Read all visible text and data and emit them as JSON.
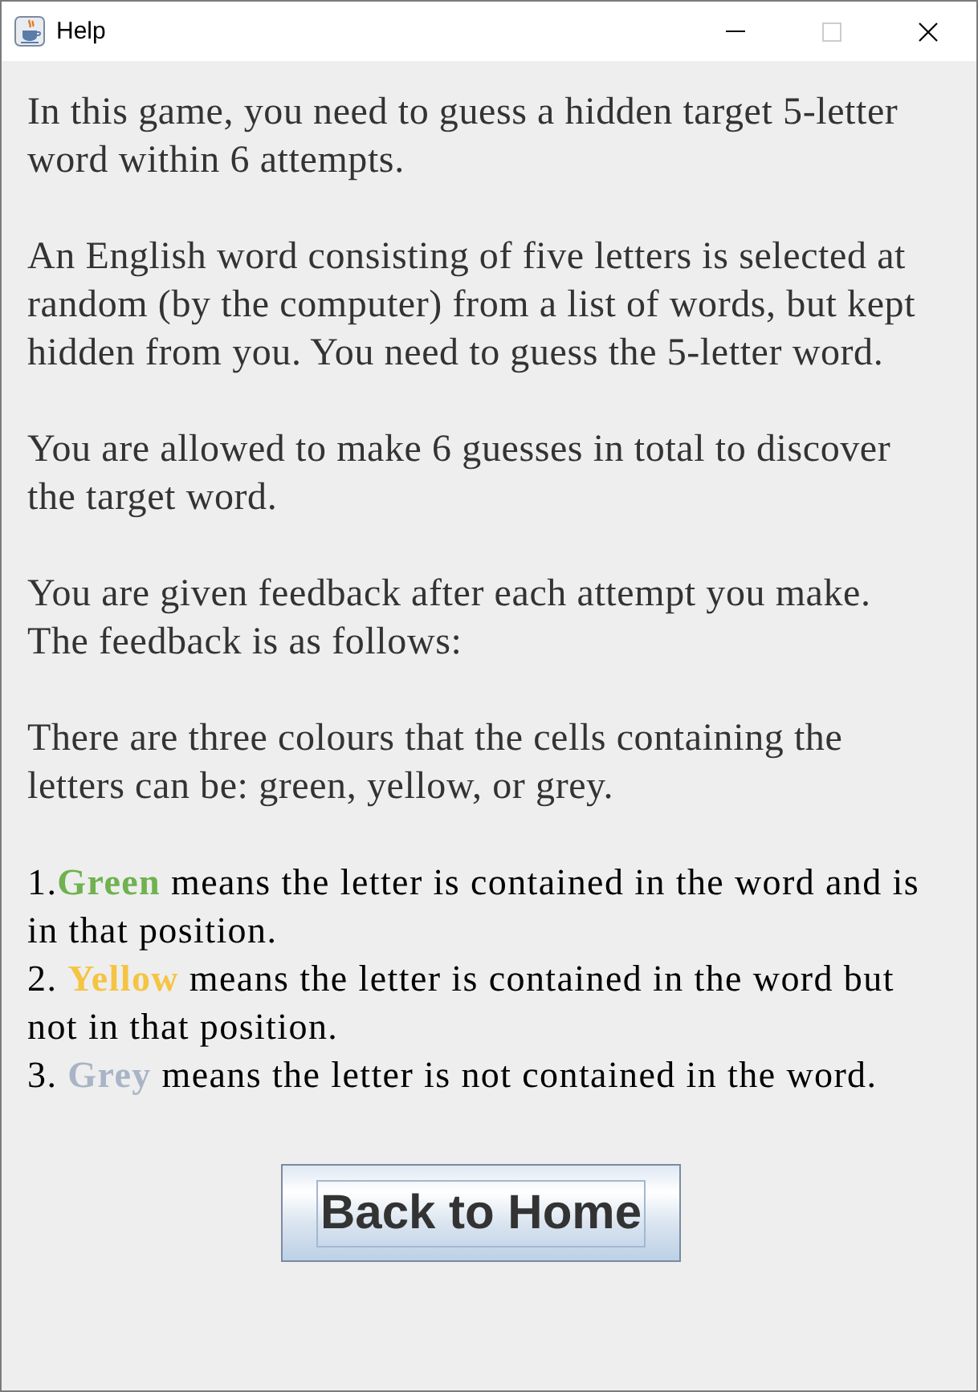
{
  "window": {
    "title": "Help",
    "controls": [
      {
        "kind": "minimize",
        "disabled": false
      },
      {
        "kind": "maximize",
        "disabled": true
      },
      {
        "kind": "close",
        "disabled": false
      }
    ]
  },
  "paragraphs": [
    "In this game, you need to guess a hidden target 5-letter word within 6 attempts.",
    "An English word consisting of five letters is selected at random (by the computer) from a list of words, but kept hidden from you. You need to guess the 5-letter word.",
    "You are allowed to make 6 guesses in total to discover the target word.",
    "You are given feedback after each attempt you make. The feedback is as follows:",
    "There are three colours that the cells containing the letters can be: green, yellow, or grey."
  ],
  "rules": [
    {
      "text": "1.**Green** means the letter is contained in the word and is in that position.",
      "color": "#6fb24f"
    },
    {
      "text": "2. **Yellow** means the letter is contained in the word but not in that position.",
      "color": "#f5c443"
    },
    {
      "text": "3. **Grey** means the letter is not contained in the word.",
      "color": "#a9b4c7"
    }
  ],
  "button": {
    "label": "Back to Home",
    "focused": true
  }
}
